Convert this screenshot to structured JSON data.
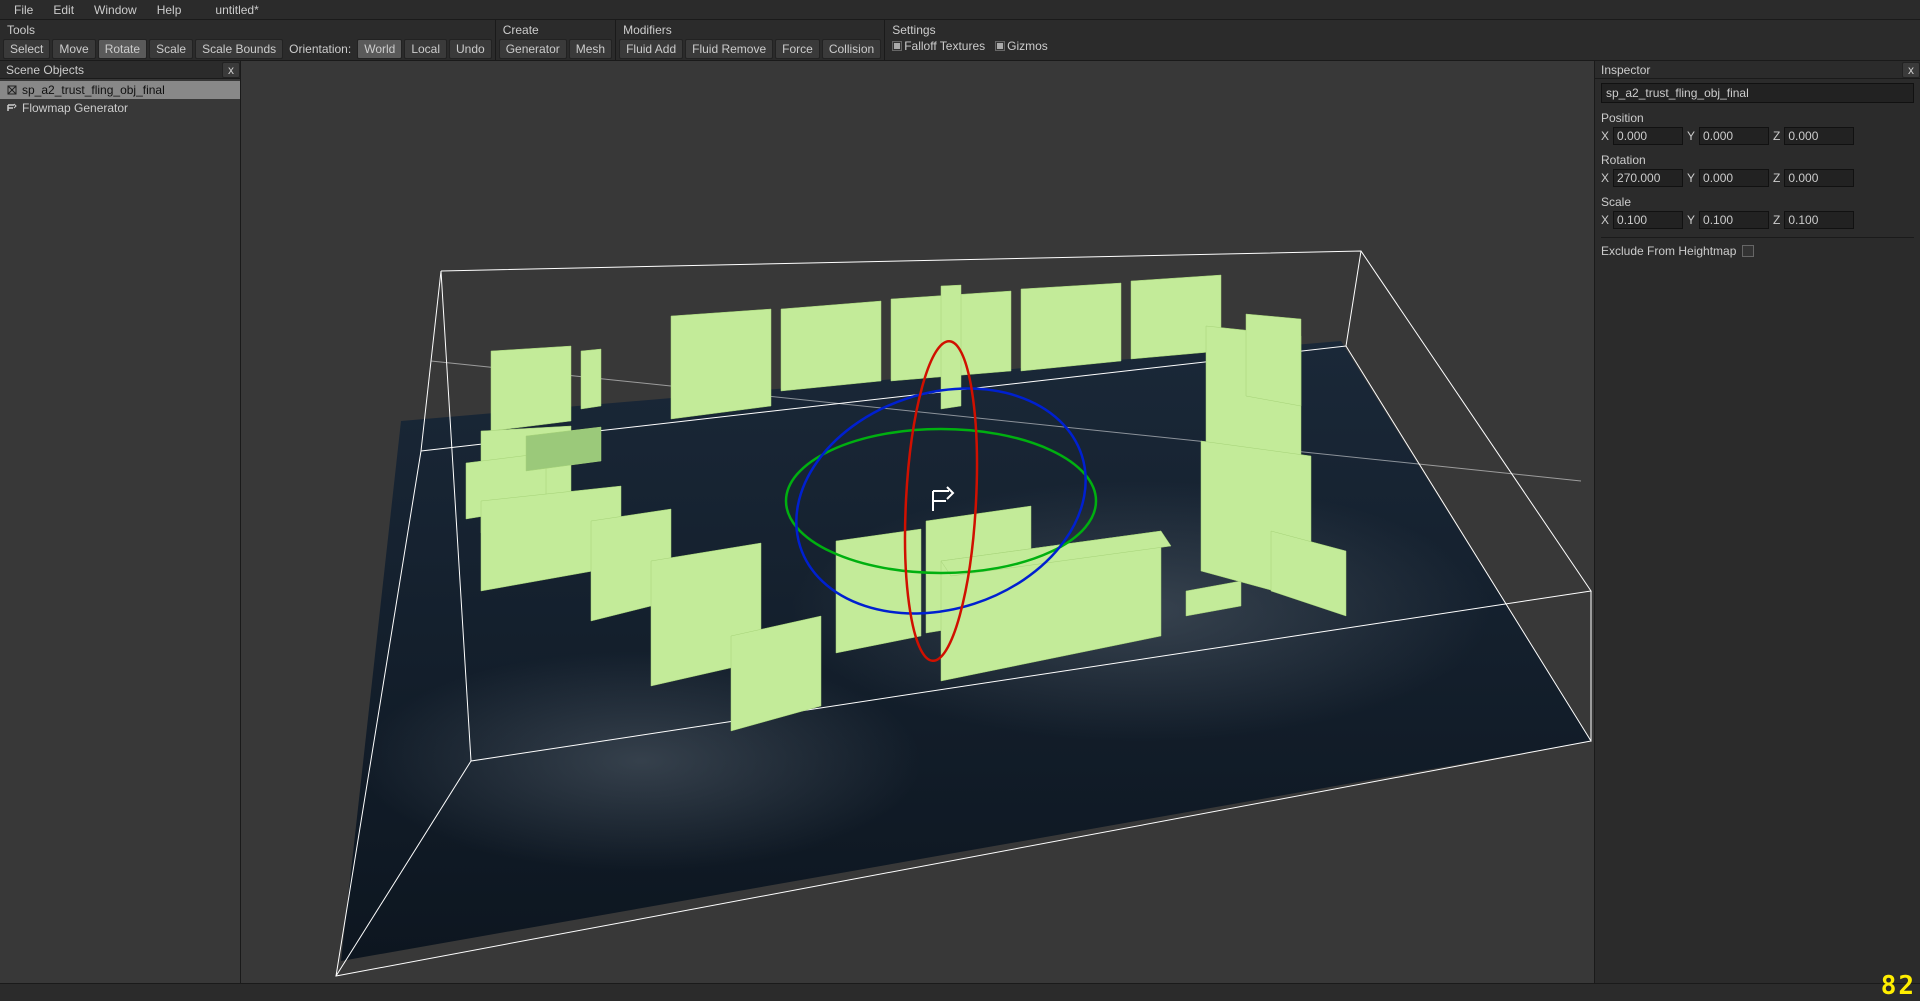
{
  "menubar": {
    "file": "File",
    "edit": "Edit",
    "window": "Window",
    "help": "Help",
    "title": "untitled*"
  },
  "toolbar": {
    "tools": {
      "title": "Tools",
      "select": "Select",
      "move": "Move",
      "rotate": "Rotate",
      "scale": "Scale",
      "scale_bounds": "Scale Bounds",
      "orientation_label": "Orientation:",
      "world": "World",
      "local": "Local",
      "undo": "Undo"
    },
    "create": {
      "title": "Create",
      "generator": "Generator",
      "mesh": "Mesh"
    },
    "modifiers": {
      "title": "Modifiers",
      "fluid_add": "Fluid Add",
      "fluid_remove": "Fluid Remove",
      "force": "Force",
      "collision": "Collision"
    },
    "settings": {
      "title": "Settings",
      "falloff": "Falloff Textures",
      "gizmos": "Gizmos"
    }
  },
  "scene_panel": {
    "title": "Scene Objects",
    "close": "x",
    "items": [
      {
        "icon": "mesh-icon",
        "label": "sp_a2_trust_fling_obj_final",
        "selected": true
      },
      {
        "icon": "flowmap-icon",
        "label": "Flowmap Generator",
        "selected": false
      }
    ]
  },
  "inspector": {
    "title": "Inspector",
    "close": "x",
    "name": "sp_a2_trust_fling_obj_final",
    "position": {
      "label": "Position",
      "x": "0.000",
      "y": "0.000",
      "z": "0.000"
    },
    "rotation": {
      "label": "Rotation",
      "x": "270.000",
      "y": "0.000",
      "z": "0.000"
    },
    "scale": {
      "label": "Scale",
      "x": "0.100",
      "y": "0.100",
      "z": "0.100"
    },
    "exclude_label": "Exclude From Heightmap"
  },
  "status": {
    "fps": "82"
  }
}
